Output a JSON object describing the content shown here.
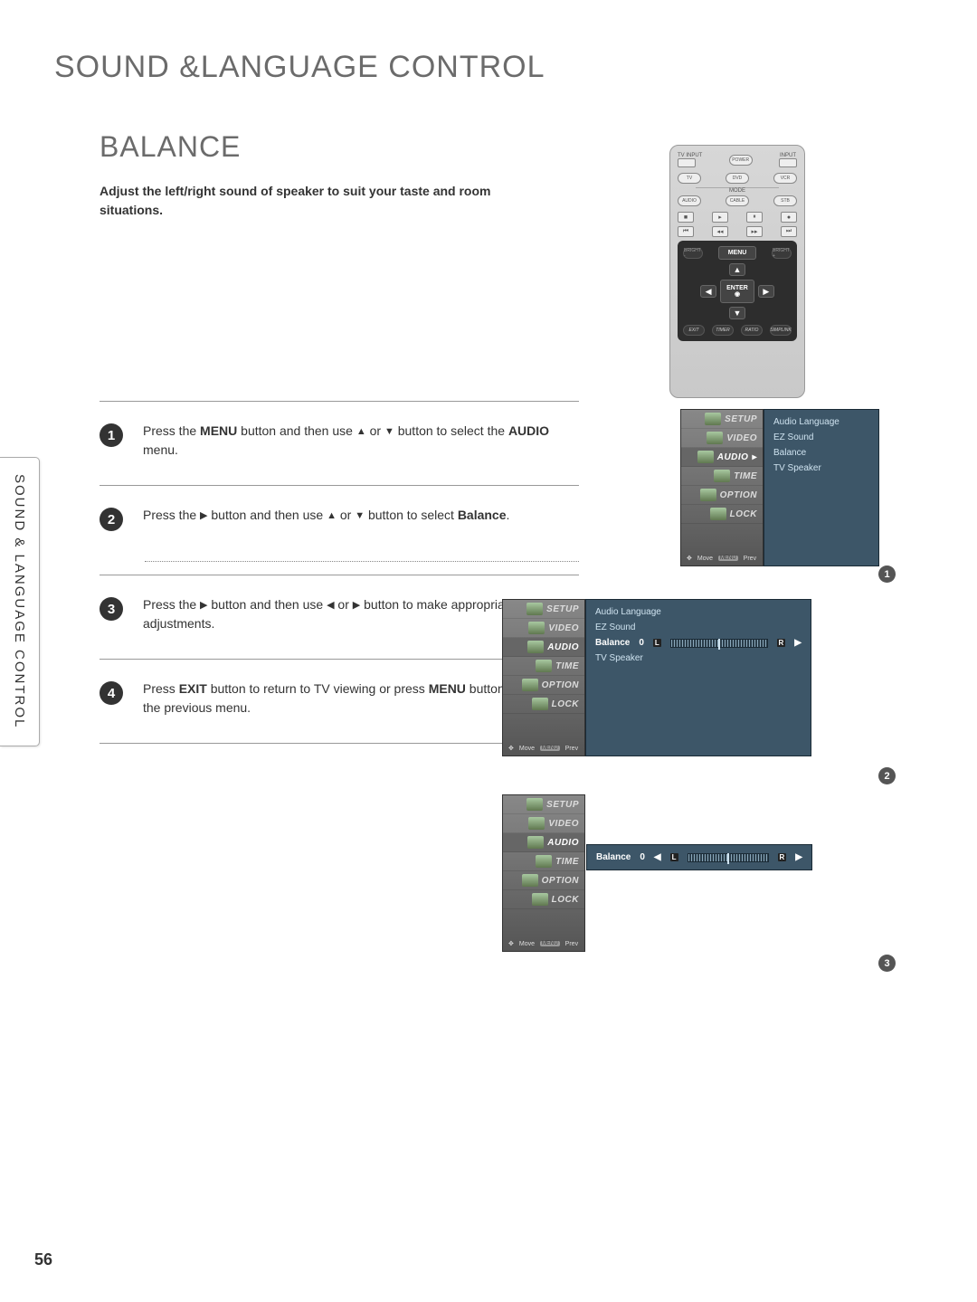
{
  "chapterTitle": "SOUND &LANGUAGE CONTROL",
  "sectionTitle": "BALANCE",
  "intro": "Adjust the left/right sound of speaker to suit your taste and room situations.",
  "sideTab": "SOUND & LANGUAGE CONTROL",
  "pageNumber": "56",
  "steps": {
    "s1": {
      "num": "1",
      "a": "Press the ",
      "b": "MENU",
      "c": " button and then use ",
      "d": " or ",
      "e": " button to select the ",
      "f": "AUDIO",
      "g": " menu."
    },
    "s2": {
      "num": "2",
      "a": "Press the ",
      "b": " button and then use ",
      "c": " or ",
      "d": " button to select ",
      "e": "Balance",
      "f": "."
    },
    "s3": {
      "num": "3",
      "a": "Press the ",
      "b": " button and then use ",
      "c": " or ",
      "d": " button to make appropriate adjustments."
    },
    "s4": {
      "num": "4",
      "a": "Press ",
      "b": "EXIT",
      "c": " button to return to TV viewing or press ",
      "d": "MENU",
      "e": " button to return to the previous menu."
    }
  },
  "remote": {
    "tvinput": "TV INPUT",
    "input": "INPUT",
    "power": "POWER",
    "tv": "TV",
    "dvd": "DVD",
    "vcr": "VCR",
    "mode": "MODE",
    "audio": "AUDIO",
    "cable": "CABLE",
    "stb": "STB",
    "bright_minus": "BRIGHT -",
    "bright_plus": "BRIGHT +",
    "menu": "MENU",
    "enter": "ENTER",
    "enter_dot": "◉",
    "exit": "EXIT",
    "timer": "TIMER",
    "ratio": "RATIO",
    "simplink": "SIMPLINK"
  },
  "osdLeft": {
    "setup": "SETUP",
    "video": "VIDEO",
    "audio": "AUDIO",
    "time": "TIME",
    "option": "OPTION",
    "lock": "LOCK",
    "move": "Move",
    "prev": "Prev"
  },
  "osdRight": {
    "audio_language": "Audio Language",
    "ez_sound": "EZ Sound",
    "balance": "Balance",
    "tv_speaker": "TV Speaker",
    "balance_value": "0",
    "L": "L",
    "R": "R"
  },
  "shotNums": {
    "n1": "1",
    "n2": "2",
    "n3": "3"
  }
}
